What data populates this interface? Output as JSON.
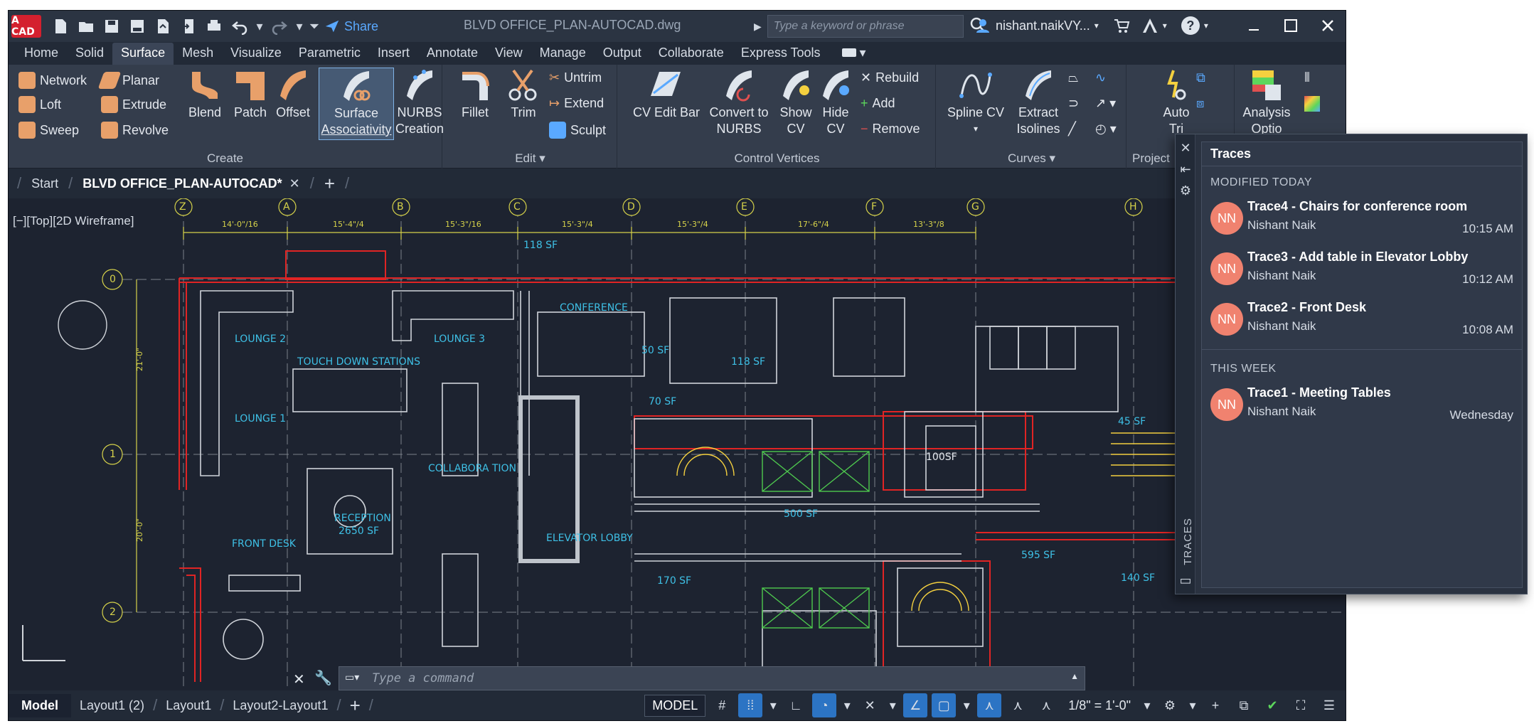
{
  "app": {
    "logo_text": "A CAD",
    "doc_title": "BLVD OFFICE_PLAN-AUTOCAD.dwg",
    "share_label": "Share",
    "search_placeholder": "Type a keyword or phrase",
    "user_name": "nishant.naikVY..."
  },
  "ribbon_tabs": [
    "Home",
    "Solid",
    "Surface",
    "Mesh",
    "Visualize",
    "Parametric",
    "Insert",
    "Annotate",
    "View",
    "Manage",
    "Output",
    "Collaborate",
    "Express Tools"
  ],
  "ribbon": {
    "create": {
      "label": "Create",
      "network": "Network",
      "planar": "Planar",
      "loft": "Loft",
      "extrude": "Extrude",
      "sweep": "Sweep",
      "revolve": "Revolve",
      "blend": "Blend",
      "patch": "Patch",
      "offset": "Offset",
      "surface_assoc_1": "Surface",
      "surface_assoc_2": "Associativity",
      "nurbs_1": "NURBS",
      "nurbs_2": "Creation"
    },
    "edit": {
      "label": "Edit",
      "fillet": "Fillet",
      "trim": "Trim",
      "untrim": "Untrim",
      "extend": "Extend",
      "sculpt": "Sculpt"
    },
    "cv": {
      "label": "Control Vertices",
      "cv_edit_bar": "CV Edit Bar",
      "convert_1": "Convert to",
      "convert_2": "NURBS",
      "show_1": "Show",
      "show_2": "CV",
      "hide_1": "Hide",
      "hide_2": "CV",
      "rebuild": "Rebuild",
      "add": "Add",
      "remove": "Remove"
    },
    "curves": {
      "label": "Curves",
      "spline_cv": "Spline CV",
      "extract_1": "Extract",
      "extract_2": "Isolines"
    },
    "project": {
      "label": "Project",
      "auto_1": "Auto",
      "auto_2": "Tri"
    },
    "analysis": {
      "label_1": "Analysis",
      "label_2": "Optio"
    }
  },
  "doc_tabs": {
    "start": "Start",
    "active": "BLVD OFFICE_PLAN-AUTOCAD*"
  },
  "canvas": {
    "viewport_label": "[−][Top][2D Wireframe]",
    "grid_letters": [
      "Z",
      "A",
      "B",
      "C",
      "D",
      "E",
      "F",
      "G",
      "H"
    ],
    "grid_numbers": [
      "0",
      "1",
      "2"
    ],
    "dims": [
      "14'-0\"/16",
      "15'-4\"/4",
      "15'-3\"/16",
      "15'-3\"/4",
      "15'-3\"/4",
      "17'-6\"/4",
      "13'-3\"/8"
    ],
    "side_dims": [
      "21'-0\"",
      "20'-0\""
    ],
    "rooms": [
      {
        "name": "118 SF"
      },
      {
        "name": "LOUNGE 2"
      },
      {
        "name": "LOUNGE 3"
      },
      {
        "name": "CONFERENCE"
      },
      {
        "name": "TOUCH DOWN STATIONS"
      },
      {
        "name": "50 SF"
      },
      {
        "name": "118 SF"
      },
      {
        "name": "LOUNGE 1"
      },
      {
        "name": "70 SF"
      },
      {
        "name": "100SF"
      },
      {
        "name": "45 SF"
      },
      {
        "name": "COLLABORA TION"
      },
      {
        "name": "RECEPTION"
      },
      {
        "name": "2650 SF"
      },
      {
        "name": "500 SF"
      },
      {
        "name": "FRONT DESK"
      },
      {
        "name": "ELEVATOR LOBBY"
      },
      {
        "name": "595 SF"
      },
      {
        "name": "170 SF"
      },
      {
        "name": "140 SF"
      }
    ],
    "command_placeholder": "Type a command"
  },
  "status": {
    "model_tab": "Model",
    "layouts": [
      "Layout1 (2)",
      "Layout1",
      "Layout2-Layout1"
    ],
    "model_badge": "MODEL",
    "scale": "1/8\" = 1'-0\""
  },
  "traces": {
    "title": "Traces",
    "vertical_label": "TRACES",
    "section_today": "MODIFIED TODAY",
    "section_week": "THIS WEEK",
    "items_today": [
      {
        "initials": "NN",
        "title": "Trace4 - Chairs for conference room",
        "author": "Nishant Naik",
        "time": "10:15 AM"
      },
      {
        "initials": "NN",
        "title": "Trace3 - Add table in Elevator Lobby",
        "author": "Nishant Naik",
        "time": "10:12 AM"
      },
      {
        "initials": "NN",
        "title": "Trace2 - Front Desk",
        "author": "Nishant Naik",
        "time": "10:08 AM"
      }
    ],
    "items_week": [
      {
        "initials": "NN",
        "title": "Trace1 - Meeting Tables",
        "author": "Nishant Naik",
        "time": "Wednesday"
      }
    ]
  },
  "colors": {
    "accent": "#2c74c4",
    "avatar": "#f0826f",
    "brand": "#d4202e",
    "cad_text": "#3ec0e6",
    "wall": "#d0d4da",
    "red_line": "#e02424"
  }
}
